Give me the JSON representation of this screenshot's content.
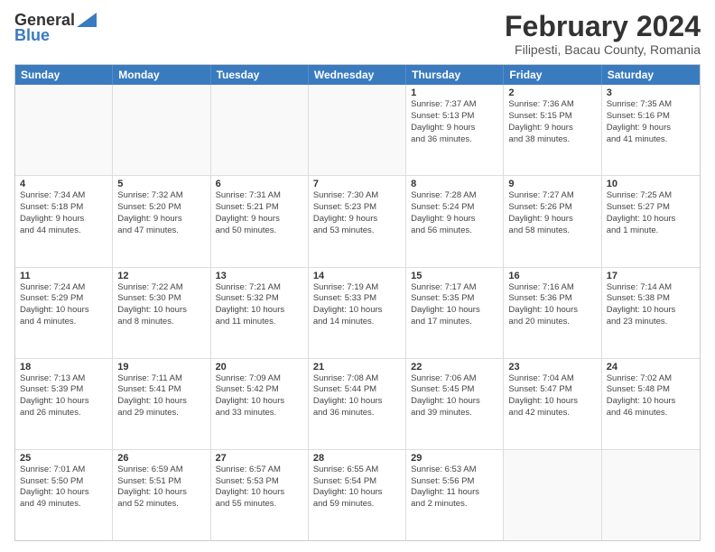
{
  "logo": {
    "line1": "General",
    "line2": "Blue"
  },
  "title": "February 2024",
  "subtitle": "Filipesti, Bacau County, Romania",
  "header_days": [
    "Sunday",
    "Monday",
    "Tuesday",
    "Wednesday",
    "Thursday",
    "Friday",
    "Saturday"
  ],
  "rows": [
    [
      {
        "day": "",
        "text": ""
      },
      {
        "day": "",
        "text": ""
      },
      {
        "day": "",
        "text": ""
      },
      {
        "day": "",
        "text": ""
      },
      {
        "day": "1",
        "text": "Sunrise: 7:37 AM\nSunset: 5:13 PM\nDaylight: 9 hours\nand 36 minutes."
      },
      {
        "day": "2",
        "text": "Sunrise: 7:36 AM\nSunset: 5:15 PM\nDaylight: 9 hours\nand 38 minutes."
      },
      {
        "day": "3",
        "text": "Sunrise: 7:35 AM\nSunset: 5:16 PM\nDaylight: 9 hours\nand 41 minutes."
      }
    ],
    [
      {
        "day": "4",
        "text": "Sunrise: 7:34 AM\nSunset: 5:18 PM\nDaylight: 9 hours\nand 44 minutes."
      },
      {
        "day": "5",
        "text": "Sunrise: 7:32 AM\nSunset: 5:20 PM\nDaylight: 9 hours\nand 47 minutes."
      },
      {
        "day": "6",
        "text": "Sunrise: 7:31 AM\nSunset: 5:21 PM\nDaylight: 9 hours\nand 50 minutes."
      },
      {
        "day": "7",
        "text": "Sunrise: 7:30 AM\nSunset: 5:23 PM\nDaylight: 9 hours\nand 53 minutes."
      },
      {
        "day": "8",
        "text": "Sunrise: 7:28 AM\nSunset: 5:24 PM\nDaylight: 9 hours\nand 56 minutes."
      },
      {
        "day": "9",
        "text": "Sunrise: 7:27 AM\nSunset: 5:26 PM\nDaylight: 9 hours\nand 58 minutes."
      },
      {
        "day": "10",
        "text": "Sunrise: 7:25 AM\nSunset: 5:27 PM\nDaylight: 10 hours\nand 1 minute."
      }
    ],
    [
      {
        "day": "11",
        "text": "Sunrise: 7:24 AM\nSunset: 5:29 PM\nDaylight: 10 hours\nand 4 minutes."
      },
      {
        "day": "12",
        "text": "Sunrise: 7:22 AM\nSunset: 5:30 PM\nDaylight: 10 hours\nand 8 minutes."
      },
      {
        "day": "13",
        "text": "Sunrise: 7:21 AM\nSunset: 5:32 PM\nDaylight: 10 hours\nand 11 minutes."
      },
      {
        "day": "14",
        "text": "Sunrise: 7:19 AM\nSunset: 5:33 PM\nDaylight: 10 hours\nand 14 minutes."
      },
      {
        "day": "15",
        "text": "Sunrise: 7:17 AM\nSunset: 5:35 PM\nDaylight: 10 hours\nand 17 minutes."
      },
      {
        "day": "16",
        "text": "Sunrise: 7:16 AM\nSunset: 5:36 PM\nDaylight: 10 hours\nand 20 minutes."
      },
      {
        "day": "17",
        "text": "Sunrise: 7:14 AM\nSunset: 5:38 PM\nDaylight: 10 hours\nand 23 minutes."
      }
    ],
    [
      {
        "day": "18",
        "text": "Sunrise: 7:13 AM\nSunset: 5:39 PM\nDaylight: 10 hours\nand 26 minutes."
      },
      {
        "day": "19",
        "text": "Sunrise: 7:11 AM\nSunset: 5:41 PM\nDaylight: 10 hours\nand 29 minutes."
      },
      {
        "day": "20",
        "text": "Sunrise: 7:09 AM\nSunset: 5:42 PM\nDaylight: 10 hours\nand 33 minutes."
      },
      {
        "day": "21",
        "text": "Sunrise: 7:08 AM\nSunset: 5:44 PM\nDaylight: 10 hours\nand 36 minutes."
      },
      {
        "day": "22",
        "text": "Sunrise: 7:06 AM\nSunset: 5:45 PM\nDaylight: 10 hours\nand 39 minutes."
      },
      {
        "day": "23",
        "text": "Sunrise: 7:04 AM\nSunset: 5:47 PM\nDaylight: 10 hours\nand 42 minutes."
      },
      {
        "day": "24",
        "text": "Sunrise: 7:02 AM\nSunset: 5:48 PM\nDaylight: 10 hours\nand 46 minutes."
      }
    ],
    [
      {
        "day": "25",
        "text": "Sunrise: 7:01 AM\nSunset: 5:50 PM\nDaylight: 10 hours\nand 49 minutes."
      },
      {
        "day": "26",
        "text": "Sunrise: 6:59 AM\nSunset: 5:51 PM\nDaylight: 10 hours\nand 52 minutes."
      },
      {
        "day": "27",
        "text": "Sunrise: 6:57 AM\nSunset: 5:53 PM\nDaylight: 10 hours\nand 55 minutes."
      },
      {
        "day": "28",
        "text": "Sunrise: 6:55 AM\nSunset: 5:54 PM\nDaylight: 10 hours\nand 59 minutes."
      },
      {
        "day": "29",
        "text": "Sunrise: 6:53 AM\nSunset: 5:56 PM\nDaylight: 11 hours\nand 2 minutes."
      },
      {
        "day": "",
        "text": ""
      },
      {
        "day": "",
        "text": ""
      }
    ]
  ]
}
